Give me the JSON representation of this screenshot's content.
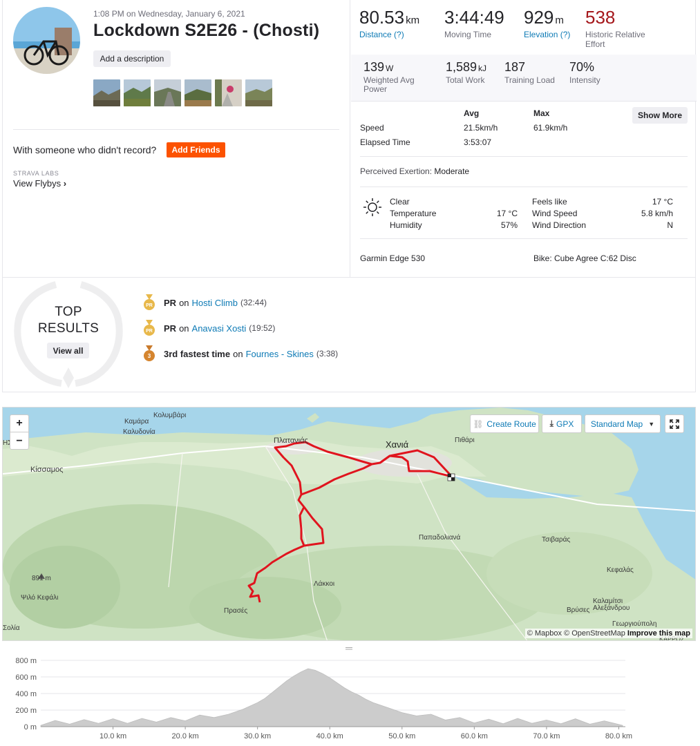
{
  "activity": {
    "date": "1:08 PM on Wednesday, January 6, 2021",
    "title": "Lockdown S2E26 - (Chosti)",
    "add_description": "Add a description",
    "with_someone": "With someone who didn't record?",
    "add_friends": "Add Friends",
    "strava_labs": "STRAVA LABS",
    "view_flybys": "View Flybys"
  },
  "stats": {
    "distance_value": "80.53",
    "distance_unit": "km",
    "distance_label": "Distance (?)",
    "moving_time_value": "3:44:49",
    "moving_time_label": "Moving Time",
    "elevation_value": "929",
    "elevation_unit": "m",
    "elevation_label": "Elevation (?)",
    "relative_effort_value": "538",
    "relative_effort_label": "Historic Relative Effort",
    "power_value": "139",
    "power_unit": "W",
    "power_label": "Weighted Avg Power",
    "work_value": "1,589",
    "work_unit": "kJ",
    "work_label": "Total Work",
    "training_load_value": "187",
    "training_load_label": "Training Load",
    "intensity_value": "70%",
    "intensity_label": "Intensity"
  },
  "table": {
    "avg_header": "Avg",
    "max_header": "Max",
    "show_more": "Show More",
    "rows": [
      {
        "label": "Speed",
        "avg": "21.5km/h",
        "max": "61.9km/h"
      },
      {
        "label": "Elapsed Time",
        "avg": "3:53:07",
        "max": ""
      }
    ],
    "perceived_label": "Perceived Exertion:",
    "perceived_value": "Moderate"
  },
  "weather": {
    "condition": "Clear",
    "temperature_label": "Temperature",
    "temperature_value": "17 °C",
    "humidity_label": "Humidity",
    "humidity_value": "57%",
    "feels_like_label": "Feels like",
    "feels_like_value": "17 °C",
    "wind_speed_label": "Wind Speed",
    "wind_speed_value": "5.8 km/h",
    "wind_direction_label": "Wind Direction",
    "wind_direction_value": "N",
    "icon": "sun-icon"
  },
  "gear": {
    "device": "Garmin Edge 530",
    "bike": "Bike: Cube Agree C:62 Disc"
  },
  "top_results": {
    "title_line1": "TOP",
    "title_line2": "RESULTS",
    "view_all": "View all",
    "items": [
      {
        "badge": "PR",
        "label": "PR",
        "on": "on",
        "segment": "Hosti Climb",
        "time": "(32:44)"
      },
      {
        "badge": "PR",
        "label": "PR",
        "on": "on",
        "segment": "Anavasi Xosti",
        "time": "(19:52)"
      },
      {
        "badge": "3",
        "label": "3rd fastest time",
        "on": "on",
        "segment": "Fournes - Skines",
        "time": "(3:38)"
      }
    ]
  },
  "map": {
    "zoom_in": "+",
    "zoom_out": "−",
    "create_route": "Create Route",
    "gpx": "GPX",
    "map_style": "Standard Map",
    "attribution_1": "© Mapbox © OpenStreetMap",
    "attribution_2": "Improve this map",
    "labels": {
      "kamara": "Καμάρα",
      "kolymvari": "Κολυμβάρι",
      "kalydonia": "Καλυδονία",
      "nisiou": "ΗΣΙΟΥ",
      "kissamos": "Κίσσαμος",
      "platanias": "Πλατανιάς",
      "chania": "Χανιά",
      "pithari": "Πιθάρι",
      "papadoliana": "Παπαδολιανά",
      "tsivaras": "Τσιβαράς",
      "kefalas": "Κεφαλάς",
      "lakkoi": "Λάκκοι",
      "prases": "Πρασές",
      "peak_elev": "891 m",
      "peak_name": "Ψιλό Κεφάλι",
      "vrises": "Βρύσες",
      "kalamitsi": "Καλαμίτσι Αλεξάνδρου",
      "georgioupoli": "Γεωργιούπολη",
      "kolia": "Σολία",
      "karros": "ΚΑΡΡΟΣ"
    },
    "colors": {
      "route": "#e0141e",
      "water": "#a6d5ea",
      "land": "#cfe3c4"
    }
  },
  "chart_data": {
    "type": "area",
    "xlabel": "",
    "ylabel": "",
    "xlim": [
      0,
      80.53
    ],
    "ylim": [
      0,
      800
    ],
    "x_ticks": [
      "10.0 km",
      "20.0 km",
      "30.0 km",
      "40.0 km",
      "50.0 km",
      "60.0 km",
      "70.0 km",
      "80.0 km"
    ],
    "y_ticks": [
      "0 m",
      "200 m",
      "400 m",
      "600 m",
      "800 m"
    ],
    "x": [
      0,
      2,
      4,
      6,
      8,
      10,
      12,
      14,
      16,
      18,
      20,
      22,
      24,
      26,
      28,
      30,
      31,
      32,
      33,
      34,
      35,
      36,
      37,
      38,
      39,
      40,
      41,
      42,
      43,
      44,
      45,
      46,
      48,
      50,
      52,
      54,
      56,
      58,
      60,
      62,
      64,
      66,
      68,
      70,
      72,
      74,
      76,
      78,
      80.53
    ],
    "y": [
      15,
      25,
      30,
      35,
      40,
      45,
      40,
      50,
      55,
      60,
      70,
      90,
      110,
      150,
      210,
      290,
      340,
      410,
      480,
      550,
      610,
      660,
      700,
      680,
      640,
      590,
      530,
      470,
      420,
      380,
      330,
      290,
      230,
      170,
      130,
      100,
      80,
      60,
      45,
      40,
      35,
      50,
      40,
      30,
      35,
      45,
      30,
      20,
      15
    ],
    "fill_color": "#cccccc"
  }
}
